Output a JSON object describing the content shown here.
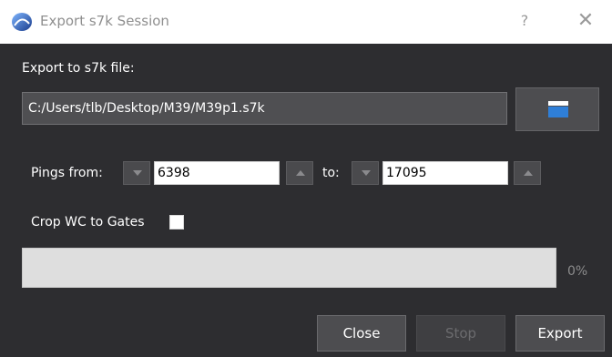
{
  "window": {
    "title": "Export s7k Session",
    "help_label": "?",
    "close_label": "✕"
  },
  "export": {
    "label": "Export to s7k file:",
    "file_path": "C:/Users/tlb/Desktop/M39/M39p1.s7k"
  },
  "pings": {
    "from_label": "Pings from:",
    "from_value": "6398",
    "to_label": "to:",
    "to_value": "17095"
  },
  "crop": {
    "label": "Crop WC to Gates",
    "checked": false
  },
  "progress": {
    "value": 0,
    "text": "0%"
  },
  "buttons": {
    "close": "Close",
    "stop": "Stop",
    "export": "Export"
  },
  "colors": {
    "background": "#2d2d30",
    "titlebar": "#ffffff",
    "button_bg": "#4d4d50",
    "progress_track": "#dedede"
  }
}
